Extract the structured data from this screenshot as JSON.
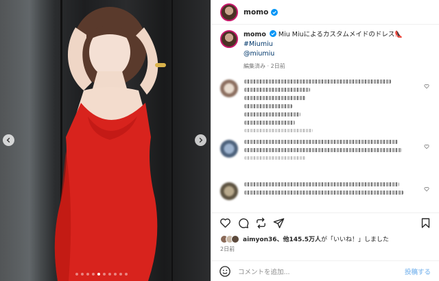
{
  "post": {
    "username": "momo",
    "verified": true
  },
  "caption": {
    "username": "momo",
    "text": "Miu Miuによるカスタムメイドのドレス👠",
    "hashtag": "#Miumiu",
    "mention": "@miumiu",
    "meta": "編集済み · 2日前"
  },
  "likes": {
    "first_user": "aimyon36",
    "others_text": "、他145.5万人",
    "suffix": "が「いいね！」しました"
  },
  "date": "2日前",
  "compose": {
    "placeholder": "コメントを追加...",
    "post_label": "投稿する"
  },
  "carousel": {
    "count": 10,
    "active": 4
  },
  "colors": {
    "verified": "#0095f6",
    "link": "#00376b",
    "story_ring": "#c7186b"
  }
}
